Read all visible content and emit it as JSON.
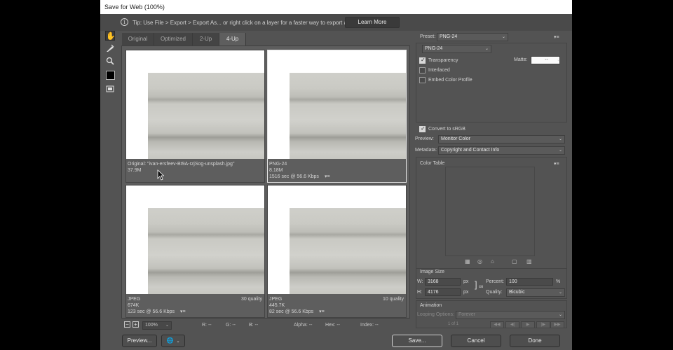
{
  "window": {
    "title": "Save for Web (100%)"
  },
  "tip": {
    "icon": "info-icon",
    "text": "Tip: Use File > Export > Export As...  or right click on a layer for a faster way to export assets",
    "learn_more": "Learn More"
  },
  "tools": [
    "hand-tool-icon",
    "slice-select-tool-icon",
    "zoom-tool-icon",
    "eyedropper-tool-icon",
    "eyedropper-color-swatch",
    "toggle-slices-visibility-icon"
  ],
  "tabs": [
    {
      "label": "Original",
      "active": false
    },
    {
      "label": "Optimized",
      "active": false
    },
    {
      "label": "2-Up",
      "active": false
    },
    {
      "label": "4-Up",
      "active": true
    }
  ],
  "panes": [
    {
      "line1": "Original: \"ivan-ersfeev-Bt9A-rzjSog-unsplash.jpg\"",
      "line2": "37.9M",
      "line3": "",
      "quality": "",
      "selected": false
    },
    {
      "line1": "PNG-24",
      "line2": "8.18M",
      "line3": "1516 sec @ 56.6 Kbps",
      "quality": "",
      "selected": true
    },
    {
      "line1": "JPEG",
      "line2": "674K",
      "line3": "123 sec @ 56.6 Kbps",
      "quality": "30 quality",
      "selected": false
    },
    {
      "line1": "JPEG",
      "line2": "445.7K",
      "line3": "82 sec @ 56.6 Kbps",
      "quality": "10 quality",
      "selected": false
    }
  ],
  "status": {
    "zoom": "100%",
    "r": "R: --",
    "g": "G: --",
    "b": "B: --",
    "alpha": "Alpha: --",
    "hex": "Hex: --",
    "index": "Index: --"
  },
  "buttons": {
    "preview": "Preview...",
    "save": "Save...",
    "cancel": "Cancel",
    "done": "Done"
  },
  "settings": {
    "preset_label": "Preset:",
    "preset_value": "PNG-24",
    "format_value": "PNG-24",
    "transparency": "Transparency",
    "matte_label": "Matte:",
    "matte_value": "--",
    "interlaced": "Interlaced",
    "embed_profile": "Embed Color Profile",
    "convert_srgb": "Convert to sRGB",
    "preview_label": "Preview:",
    "preview_value": "Monitor Color",
    "metadata_label": "Metadata:",
    "metadata_value": "Copyright and Contact Info",
    "color_table": "Color Table"
  },
  "image_size": {
    "title": "Image Size",
    "w_label": "W:",
    "w_value": "3168",
    "h_label": "H:",
    "h_value": "4176",
    "unit": "px",
    "percent_label": "Percent:",
    "percent_value": "100",
    "percent_unit": "%",
    "quality_label": "Quality:",
    "quality_value": "Bicubic"
  },
  "animation": {
    "title": "Animation",
    "looping_label": "Looping Options:",
    "looping_value": "Forever",
    "frame_counter": "1 of 1"
  }
}
